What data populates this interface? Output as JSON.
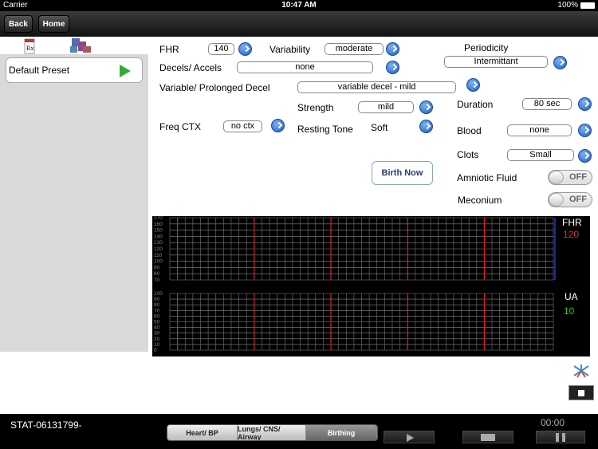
{
  "status": {
    "carrier": "Carrier",
    "time": "10:47 AM",
    "battery": "100%"
  },
  "nav": {
    "back": "Back",
    "home": "Home"
  },
  "sidebar": {
    "preset_label": "Default Preset"
  },
  "form": {
    "fhr": {
      "label": "FHR",
      "value": "140"
    },
    "variability": {
      "label": "Variability",
      "value": "moderate"
    },
    "periodicity": {
      "label": "Periodicity",
      "value": "Intermittant"
    },
    "decels": {
      "label": "Decels/ Accels",
      "value": "none"
    },
    "variable_decel": {
      "label": "Variable/ Prolonged Decel",
      "value": "variable decel - mild"
    },
    "strength": {
      "label": "Strength",
      "value": "mild"
    },
    "duration": {
      "label": "Duration",
      "value": "80 sec"
    },
    "freq_ctx": {
      "label": "Freq CTX",
      "value": "no ctx"
    },
    "resting_tone": {
      "label": "Resting Tone",
      "value": "Soft"
    },
    "blood": {
      "label": "Blood",
      "value": "none"
    },
    "clots": {
      "label": "Clots",
      "value": "Small"
    },
    "amniotic": {
      "label": "Amniotic Fluid",
      "toggle": "OFF"
    },
    "meconium": {
      "label": "Meconium",
      "toggle": "OFF"
    },
    "birth_now": "Birth Now"
  },
  "chart": {
    "fhr_label": "FHR",
    "fhr_value": "120",
    "ua_label": "UA",
    "ua_value": "10",
    "fhr_ticks": [
      "170",
      "160",
      "150",
      "140",
      "130",
      "120",
      "110",
      "100",
      "90",
      "80",
      "70"
    ],
    "ua_ticks": [
      "100",
      "90",
      "80",
      "70",
      "60",
      "50",
      "40",
      "30",
      "20",
      "10",
      "0"
    ]
  },
  "bottom": {
    "patient_id": "STAT-06131799-",
    "timer": "00:00",
    "tabs": [
      "Heart/ BP",
      "Lungs/ CNS/ Airway",
      "Birthing"
    ],
    "active_tab": "Birthing"
  }
}
